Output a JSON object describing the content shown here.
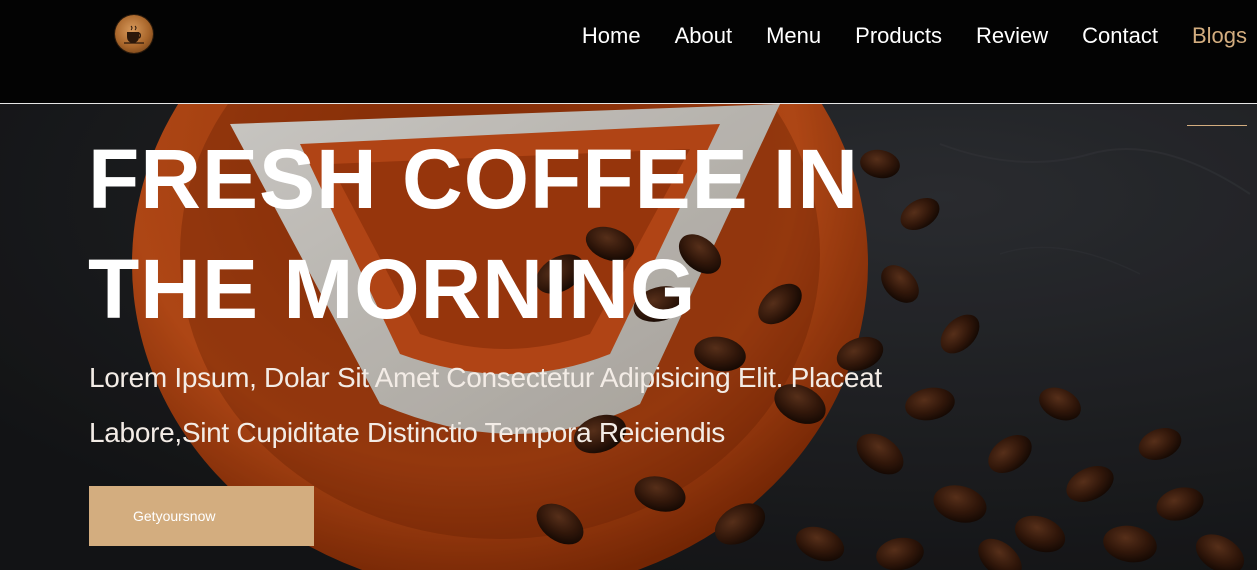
{
  "header": {
    "logo_icon": "coffee-cup-logo",
    "nav": [
      {
        "label": "Home"
      },
      {
        "label": "About"
      },
      {
        "label": "Menu"
      },
      {
        "label": "Products"
      },
      {
        "label": "Review"
      },
      {
        "label": "Contact"
      },
      {
        "label": "Blogs",
        "active": true
      }
    ]
  },
  "hero": {
    "title": "FRESH COFFEE IN THE MORNING",
    "text": "Lorem Ipsum, Dolar Sit Amet Consectetur Adipisicing Elit. Placeat Labore,Sint Cupiditate Distinctio Tempora Reiciendis",
    "cta_label": "Getyoursnow",
    "background_image": "orange-coffee-cup-with-coffee-beans"
  },
  "colors": {
    "header_bg": "#030303",
    "accent": "#d3ad7f",
    "text": "#ffffff"
  }
}
